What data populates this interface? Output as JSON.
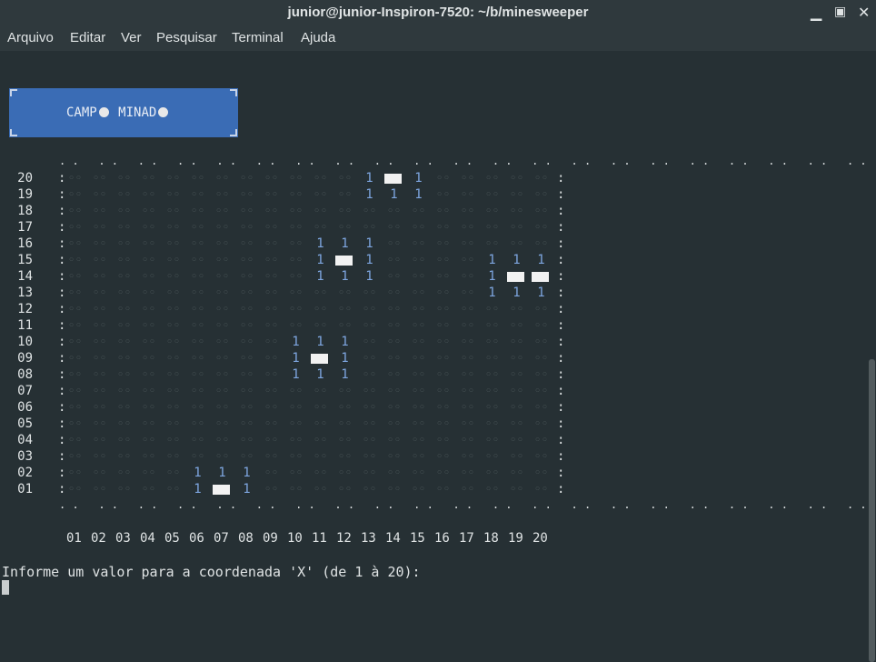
{
  "window": {
    "title": "junior@junior-Inspiron-7520: ~/b/minesweeper",
    "controls": [
      "minimize",
      "maximize",
      "close"
    ]
  },
  "menu": [
    "Arquivo",
    "Editar",
    "Ver",
    "Pesquisar",
    "Terminal",
    "Ajuda"
  ],
  "logo": {
    "part1": "CAMP",
    "part2": "MINAD"
  },
  "board": {
    "border_dots": ". .   . .   . .   . .   . .   . .   . .   . .   . .   . .   . .   . .   . .   . .   . .   . .   . .   . .   . .   . .   . .",
    "row_labels": [
      "20",
      "19",
      "18",
      "17",
      "16",
      "15",
      "14",
      "13",
      "12",
      "11",
      "10",
      "09",
      "08",
      "07",
      "06",
      "05",
      "04",
      "03",
      "02",
      "01"
    ],
    "col_labels": [
      "01",
      "02",
      "03",
      "04",
      "05",
      "06",
      "07",
      "08",
      "09",
      "10",
      "11",
      "12",
      "13",
      "14",
      "15",
      "16",
      "17",
      "18",
      "19",
      "20"
    ],
    "hidden_symbol": "◦◦",
    "numbers": [
      {
        "row": "20",
        "col": 13,
        "v": "1"
      },
      {
        "row": "20",
        "col": 15,
        "v": "1"
      },
      {
        "row": "19",
        "col": 13,
        "v": "1"
      },
      {
        "row": "19",
        "col": 14,
        "v": "1"
      },
      {
        "row": "19",
        "col": 15,
        "v": "1"
      },
      {
        "row": "16",
        "col": 11,
        "v": "1"
      },
      {
        "row": "16",
        "col": 12,
        "v": "1"
      },
      {
        "row": "16",
        "col": 13,
        "v": "1"
      },
      {
        "row": "15",
        "col": 11,
        "v": "1"
      },
      {
        "row": "15",
        "col": 13,
        "v": "1"
      },
      {
        "row": "15",
        "col": 18,
        "v": "1"
      },
      {
        "row": "15",
        "col": 19,
        "v": "1"
      },
      {
        "row": "15",
        "col": 20,
        "v": "1"
      },
      {
        "row": "14",
        "col": 11,
        "v": "1"
      },
      {
        "row": "14",
        "col": 12,
        "v": "1"
      },
      {
        "row": "14",
        "col": 13,
        "v": "1"
      },
      {
        "row": "14",
        "col": 18,
        "v": "1"
      },
      {
        "row": "13",
        "col": 18,
        "v": "1"
      },
      {
        "row": "13",
        "col": 19,
        "v": "1"
      },
      {
        "row": "13",
        "col": 20,
        "v": "1"
      },
      {
        "row": "10",
        "col": 10,
        "v": "1"
      },
      {
        "row": "10",
        "col": 11,
        "v": "1"
      },
      {
        "row": "10",
        "col": 12,
        "v": "1"
      },
      {
        "row": "09",
        "col": 10,
        "v": "1"
      },
      {
        "row": "09",
        "col": 12,
        "v": "1"
      },
      {
        "row": "08",
        "col": 10,
        "v": "1"
      },
      {
        "row": "08",
        "col": 11,
        "v": "1"
      },
      {
        "row": "08",
        "col": 12,
        "v": "1"
      },
      {
        "row": "02",
        "col": 6,
        "v": "1"
      },
      {
        "row": "02",
        "col": 7,
        "v": "1"
      },
      {
        "row": "02",
        "col": 8,
        "v": "1"
      },
      {
        "row": "01",
        "col": 6,
        "v": "1"
      },
      {
        "row": "01",
        "col": 8,
        "v": "1"
      }
    ],
    "mines": [
      {
        "row": "20",
        "col": 14
      },
      {
        "row": "15",
        "col": 12
      },
      {
        "row": "14",
        "col": 19
      },
      {
        "row": "14",
        "col": 20
      },
      {
        "row": "09",
        "col": 11
      },
      {
        "row": "01",
        "col": 7
      }
    ]
  },
  "prompt": "Informe um valor para a coordenada 'X' (de 1 à 20):",
  "colors": {
    "background": "#263034",
    "number": "#7ea6e0",
    "logo": "#3a6cb5"
  }
}
